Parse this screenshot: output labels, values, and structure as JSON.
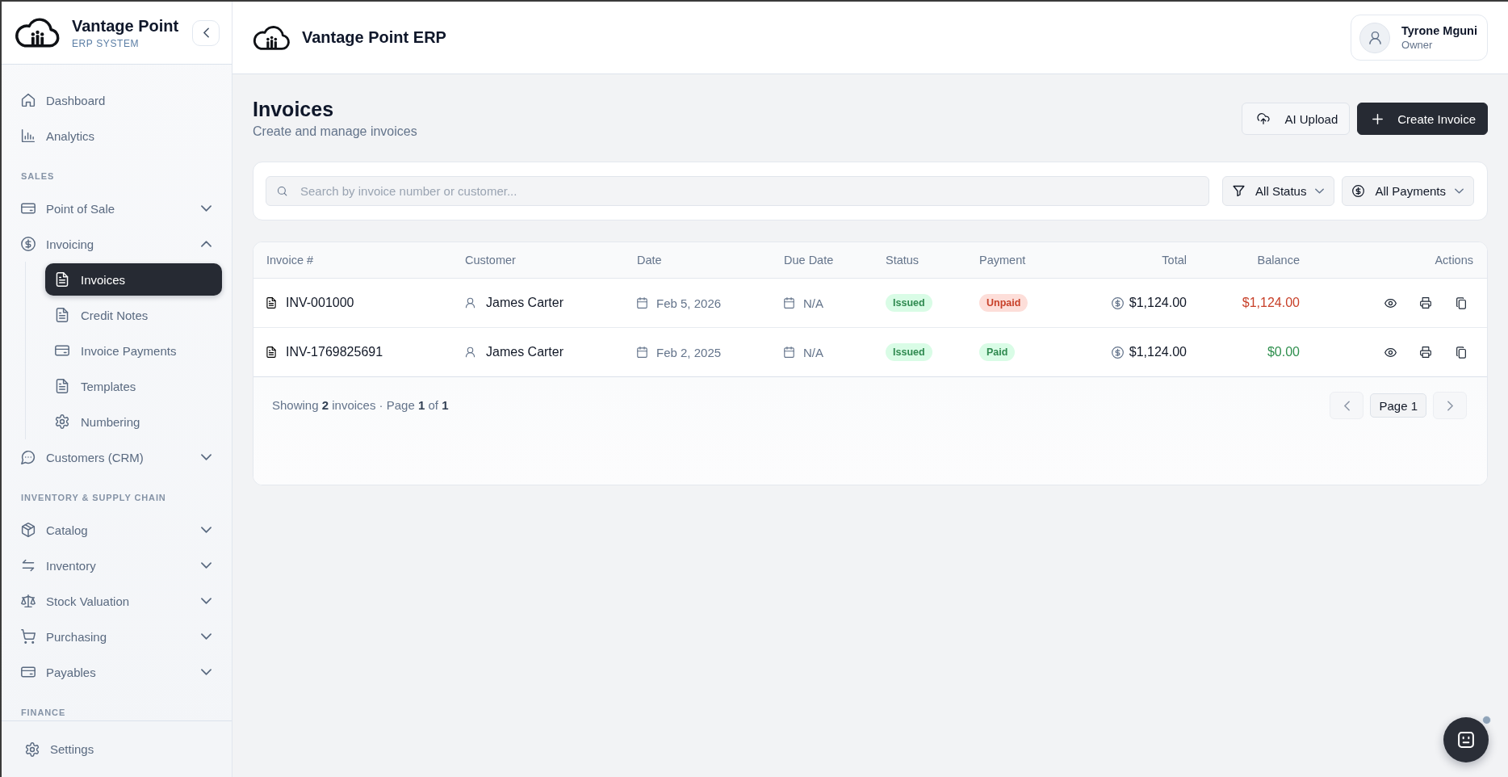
{
  "sidebar": {
    "brand": {
      "title": "Vantage Point",
      "subtitle": "ERP SYSTEM"
    },
    "sections": [
      {
        "items": [
          {
            "label": "Dashboard",
            "selected": false
          },
          {
            "label": "Analytics",
            "selected": false
          }
        ]
      },
      {
        "label": "SALES",
        "items": [
          {
            "label": "Point of Sale",
            "selected": false,
            "expanded": false
          },
          {
            "label": "Invoicing",
            "selected": false,
            "expanded": true,
            "children": [
              {
                "label": "Invoices",
                "selected": true
              },
              {
                "label": "Credit Notes",
                "selected": false
              },
              {
                "label": "Invoice Payments",
                "selected": false
              },
              {
                "label": "Templates",
                "selected": false
              },
              {
                "label": "Numbering",
                "selected": false
              }
            ]
          },
          {
            "label": "Customers (CRM)",
            "selected": false,
            "expanded": false
          }
        ]
      },
      {
        "label": "INVENTORY & SUPPLY CHAIN",
        "items": [
          {
            "label": "Catalog",
            "selected": false,
            "expanded": false
          },
          {
            "label": "Inventory",
            "selected": false,
            "expanded": false
          },
          {
            "label": "Stock Valuation",
            "selected": false,
            "expanded": false
          },
          {
            "label": "Purchasing",
            "selected": false,
            "expanded": false
          },
          {
            "label": "Payables",
            "selected": false,
            "expanded": false
          }
        ]
      },
      {
        "label": "FINANCE"
      }
    ],
    "footer_items": [
      {
        "label": "Settings",
        "selected": false
      }
    ]
  },
  "top_bar": {
    "title": "Vantage Point ERP",
    "user": {
      "name": "Tyrone Mguni",
      "role": "Owner"
    }
  },
  "page_header": {
    "title": "Invoices",
    "subtitle": "Create and manage invoices",
    "actions": [
      {
        "label": "AI Upload",
        "kind": "secondary"
      },
      {
        "label": "Create Invoice",
        "kind": "primary"
      }
    ]
  },
  "filters": {
    "search": {
      "placeholder": "Search by invoice number or customer..."
    },
    "dropdowns": [
      {
        "label": "All Status"
      },
      {
        "label": "All Payments"
      }
    ]
  },
  "table": {
    "columns": [
      "Invoice #",
      "Customer",
      "Date",
      "Due Date",
      "Status",
      "Payment",
      "Total",
      "Balance",
      "Actions"
    ],
    "rows": [
      {
        "invoice": "INV-001000",
        "customer": "James Carter",
        "date": "Feb 5, 2026",
        "due_date": "N/A",
        "status": {
          "label": "Issued",
          "color": "#2f8a50"
        },
        "payment": {
          "label": "Unpaid",
          "color": "#c8412a"
        },
        "total": "$1,124.00",
        "balance": {
          "text": "$1,124.00",
          "color": "#c8412a"
        }
      },
      {
        "invoice": "INV-1769825691",
        "customer": "James Carter",
        "date": "Feb 2, 2025",
        "due_date": "N/A",
        "status": {
          "label": "Issued",
          "color": "#2f8a50"
        },
        "payment": {
          "label": "Paid",
          "color": "#2f8a50"
        },
        "total": "$1,124.00",
        "balance": {
          "text": "$0.00",
          "color": "#2f8f4e"
        }
      }
    ],
    "footer": {
      "summary": "Showing **2** invoices · Page **1** of **1**"
    },
    "pagination": {
      "prev": {
        "disabled": true
      },
      "page": "Page 1",
      "next": {
        "disabled": true
      }
    }
  },
  "assistant_button": {
    "indicator": true
  }
}
